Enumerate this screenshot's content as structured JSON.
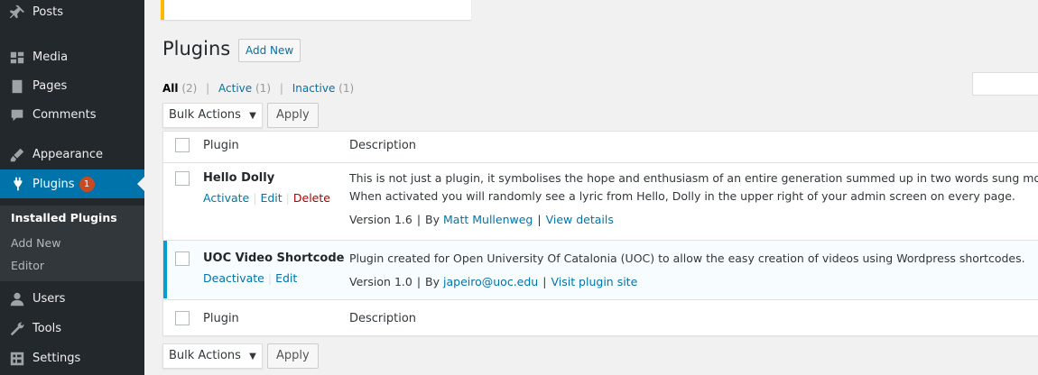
{
  "sidebar": {
    "items": [
      {
        "label": "Posts",
        "icon": "pin-icon"
      },
      {
        "label": "Media",
        "icon": "media-icon"
      },
      {
        "label": "Pages",
        "icon": "pages-icon"
      },
      {
        "label": "Comments",
        "icon": "comments-icon"
      },
      {
        "label": "Appearance",
        "icon": "brush-icon"
      },
      {
        "label": "Plugins",
        "icon": "plug-icon",
        "badge": "1"
      },
      {
        "label": "Users",
        "icon": "users-icon"
      },
      {
        "label": "Tools",
        "icon": "wrench-icon"
      },
      {
        "label": "Settings",
        "icon": "settings-icon"
      }
    ],
    "submenu": [
      "Installed Plugins",
      "Add New",
      "Editor"
    ]
  },
  "page": {
    "title": "Plugins",
    "add_new": "Add New"
  },
  "views": {
    "all": "All",
    "all_count": "(2)",
    "active": "Active",
    "active_count": "(1)",
    "inactive": "Inactive",
    "inactive_count": "(1)"
  },
  "bulk": {
    "label": "Bulk Actions",
    "arrow": "▼",
    "apply": "Apply"
  },
  "table": {
    "col_plugin": "Plugin",
    "col_description": "Description",
    "rows": [
      {
        "name": "Hello Dolly",
        "actions": [
          "Activate",
          "Edit",
          "Delete"
        ],
        "desc1": "This is not just a plugin, it symbolises the hope and enthusiasm of an entire generation summed up in two words sung most famo",
        "desc2": "When activated you will randomly see a lyric from Hello, Dolly in the upper right of your admin screen on every page.",
        "version": "Version 1.6",
        "by": "By",
        "author": "Matt Mullenweg",
        "link": "View details"
      },
      {
        "name": "UOC Video Shortcode",
        "actions": [
          "Deactivate",
          "Edit"
        ],
        "desc1": "Plugin created for Open University Of Catalonia (UOC) to allow the easy creation of videos using Wordpress shortcodes.",
        "version": "Version 1.0",
        "by": "By",
        "author": "japeiro@uoc.edu",
        "link": "Visit plugin site"
      }
    ]
  },
  "colors": {
    "sidebar": "#23282d",
    "accent": "#0073aa",
    "badge": "#ca4a1f",
    "active_border": "#00a0d2"
  }
}
